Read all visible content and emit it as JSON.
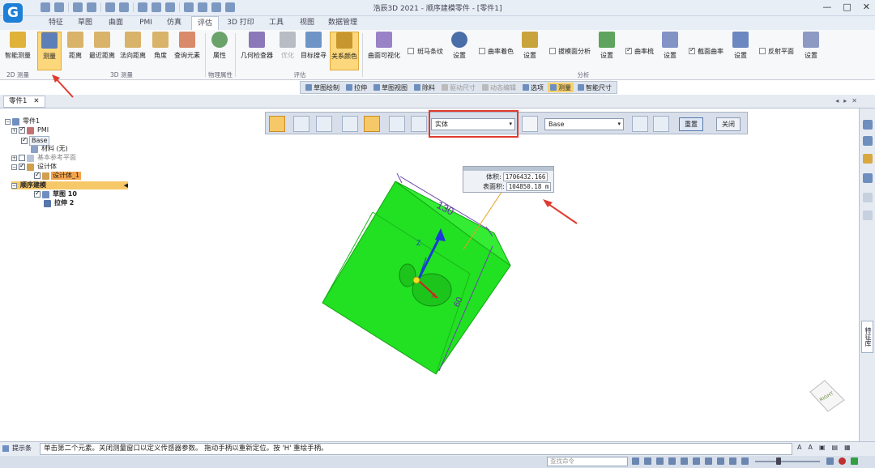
{
  "app": {
    "title": "浩辰3D 2021 - 顺序建模零件 - [零件1]",
    "logo_text": "G"
  },
  "window_controls": [
    "—",
    "□",
    "✕"
  ],
  "tabs": [
    "特征",
    "草图",
    "曲面",
    "PMI",
    "仿真",
    "评估",
    "3D 打印",
    "工具",
    "视图",
    "数据管理"
  ],
  "active_tab": "评估",
  "ribbon": {
    "buttons": {
      "smart_measure": "智能测量",
      "measure": "测量",
      "distance": "距离",
      "min_distance": "最近距离",
      "normal_distance": "法向距离",
      "angle": "角度",
      "query_element": "查询元素",
      "properties": "属性",
      "geometry_inspector": "几何检查器",
      "optimize": "优化",
      "target_search": "目标搜寻",
      "relation_color": "关系颜色",
      "curvature_visual": "曲面可视化",
      "settings": "设置"
    },
    "checks": {
      "zebra": "斑马条纹",
      "curvature_shade": "曲率着色",
      "draft_analysis": "拔模面分析",
      "curvature_comb": "曲率梳",
      "section_curvature": "截面曲率",
      "reflection_plane": "反射平面"
    },
    "groups": {
      "measure_2d": "2D 测量",
      "measure_3d": "3D 测量",
      "physical": "物理属性",
      "evaluate": "评估",
      "analysis": "分析"
    }
  },
  "toolstrip": [
    "草图绘制",
    "拉伸",
    "草图视图",
    "除料",
    "驱动尺寸",
    "动态编辑",
    "选项",
    "测量",
    "智能尺寸"
  ],
  "document_tab": "零件1",
  "document_tab_close": "✕",
  "tree": {
    "root": "零件1",
    "pmi": "PMI",
    "base": "Base",
    "material": "材料 (无)",
    "base_planes": "基本参考平面",
    "design_body": "设计体",
    "design_body_1": "设计体_1",
    "seq_modeling": "顺序建模",
    "sketch10": "草图 10",
    "extrude2": "拉伸 2"
  },
  "measure_toolbar": {
    "entity_select": "实体",
    "base_select": "Base",
    "reset": "重置",
    "close": "关闭"
  },
  "measure_result": {
    "volume_label": "体积:",
    "volume_value": "1706432.166",
    "area_label": "表面积:",
    "area_value": "104850.18 m"
  },
  "model": {
    "dim_130": "130",
    "dim_60": "60",
    "axis_z": "Z",
    "axis_x": "X"
  },
  "right_panel": {
    "vertical_tab": "特征库"
  },
  "viewcube_label": "RIGHT",
  "status": {
    "label": "提示条",
    "message": "单击第二个元素。关闭测量窗口以定义传感器参数。 拖动手柄以重新定位。按 'H' 重绘手柄。"
  },
  "bottom_bar": {
    "search_placeholder": "查找命令"
  },
  "colors": {
    "accent": "#1e7fd6",
    "highlight": "#f6c867",
    "model_green": "#2be02b",
    "annotation_red": "#e03a2e"
  }
}
